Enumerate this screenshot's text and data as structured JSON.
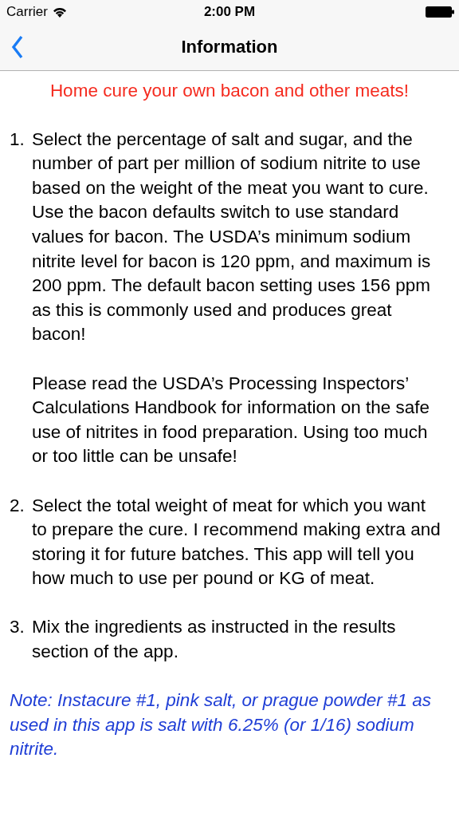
{
  "status_bar": {
    "carrier": "Carrier",
    "time": "2:00 PM"
  },
  "nav_bar": {
    "title": "Information"
  },
  "headline": "Home cure your own bacon and other meats!",
  "steps": [
    {
      "number": "1.",
      "paragraphs": [
        "Select the percentage of salt and sugar, and the number of part per million of sodium nitrite to use based on the weight of the meat you want to cure.  Use the bacon defaults switch to use standard values for bacon.  The USDA’s minimum sodium nitrite level for bacon is 120 ppm, and maximum is 200 ppm.  The default bacon setting uses 156 ppm as this is commonly used and produces great bacon!",
        "Please read the USDA’s Processing Inspectors’ Calculations Handbook for information on the safe use of nitrites in food preparation.  Using too much or too little can be unsafe!"
      ]
    },
    {
      "number": "2.",
      "paragraphs": [
        "Select the total weight of meat for which you want to prepare the cure.  I recommend making extra and storing it for future batches.  This app will tell you how much to use per pound or KG of meat."
      ]
    },
    {
      "number": "3.",
      "paragraphs": [
        "Mix the ingredients as instructed in the results section of the app."
      ]
    }
  ],
  "note": "Note: Instacure #1, pink salt, or prague powder #1 as used in this app is salt with 6.25% (or 1/16) sodium nitrite."
}
